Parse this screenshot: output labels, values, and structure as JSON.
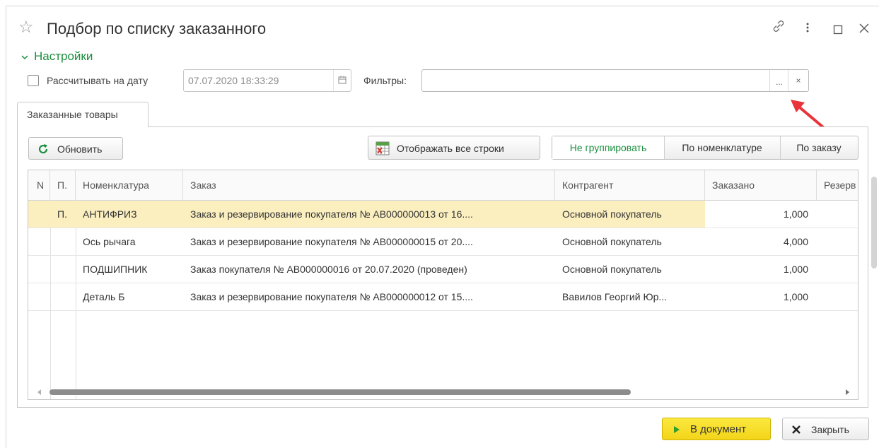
{
  "window": {
    "title": "Подбор по списку заказанного",
    "controls": [
      "link",
      "more",
      "maximize",
      "close"
    ]
  },
  "settings": {
    "header": "Настройки",
    "calc_on_date_label": "Рассчитывать на дату",
    "calc_on_date_checked": false,
    "date_value": "07.07.2020 18:33:29",
    "filters_label": "Фильтры:",
    "filters_value": "",
    "filters_select_button": "...",
    "filters_clear_button": "×"
  },
  "tabs": [
    {
      "label": "Заказанные товары",
      "active": true
    }
  ],
  "toolbar": {
    "refresh_label": "Обновить",
    "show_all_label": "Отображать все строки",
    "grouping": [
      {
        "label": "Не группировать",
        "active": true
      },
      {
        "label": "По номенклатуре",
        "active": false
      },
      {
        "label": "По заказу",
        "active": false
      }
    ]
  },
  "table": {
    "columns": [
      "N",
      "П.",
      "Номенклатура",
      "Заказ",
      "Контрагент",
      "Заказано",
      "Резерв"
    ],
    "rows": [
      {
        "n": "",
        "p": "П.",
        "item": "АНТИФРИЗ",
        "order": "Заказ и резервирование покупателя № АВ000000013 от 16....",
        "partner": "Основной покупатель",
        "qty": "1,000",
        "reserve": "",
        "selected": true
      },
      {
        "n": "",
        "p": "",
        "item": "Ось рычага",
        "order": "Заказ и резервирование покупателя № АВ000000015 от 20....",
        "partner": "Основной покупатель",
        "qty": "4,000",
        "reserve": "",
        "selected": false
      },
      {
        "n": "",
        "p": "",
        "item": "ПОДШИПНИК",
        "order": "Заказ покупателя № АВ000000016 от 20.07.2020 (проведен)",
        "partner": "Основной покупатель",
        "qty": "1,000",
        "reserve": "",
        "selected": false
      },
      {
        "n": "",
        "p": "",
        "item": "Деталь Б",
        "order": "Заказ и резервирование покупателя № АВ000000012 от 15....",
        "partner": "Вавилов Георгий Юр...",
        "qty": "1,000",
        "reserve": "",
        "selected": false
      }
    ]
  },
  "footer": {
    "to_document_label": "В документ",
    "close_label": "Закрыть"
  },
  "colors": {
    "accent_green": "#1b8f3c",
    "selected_row": "#fbefc0",
    "primary_button": "#f3d41a",
    "annotation_arrow": "#e8343a"
  }
}
